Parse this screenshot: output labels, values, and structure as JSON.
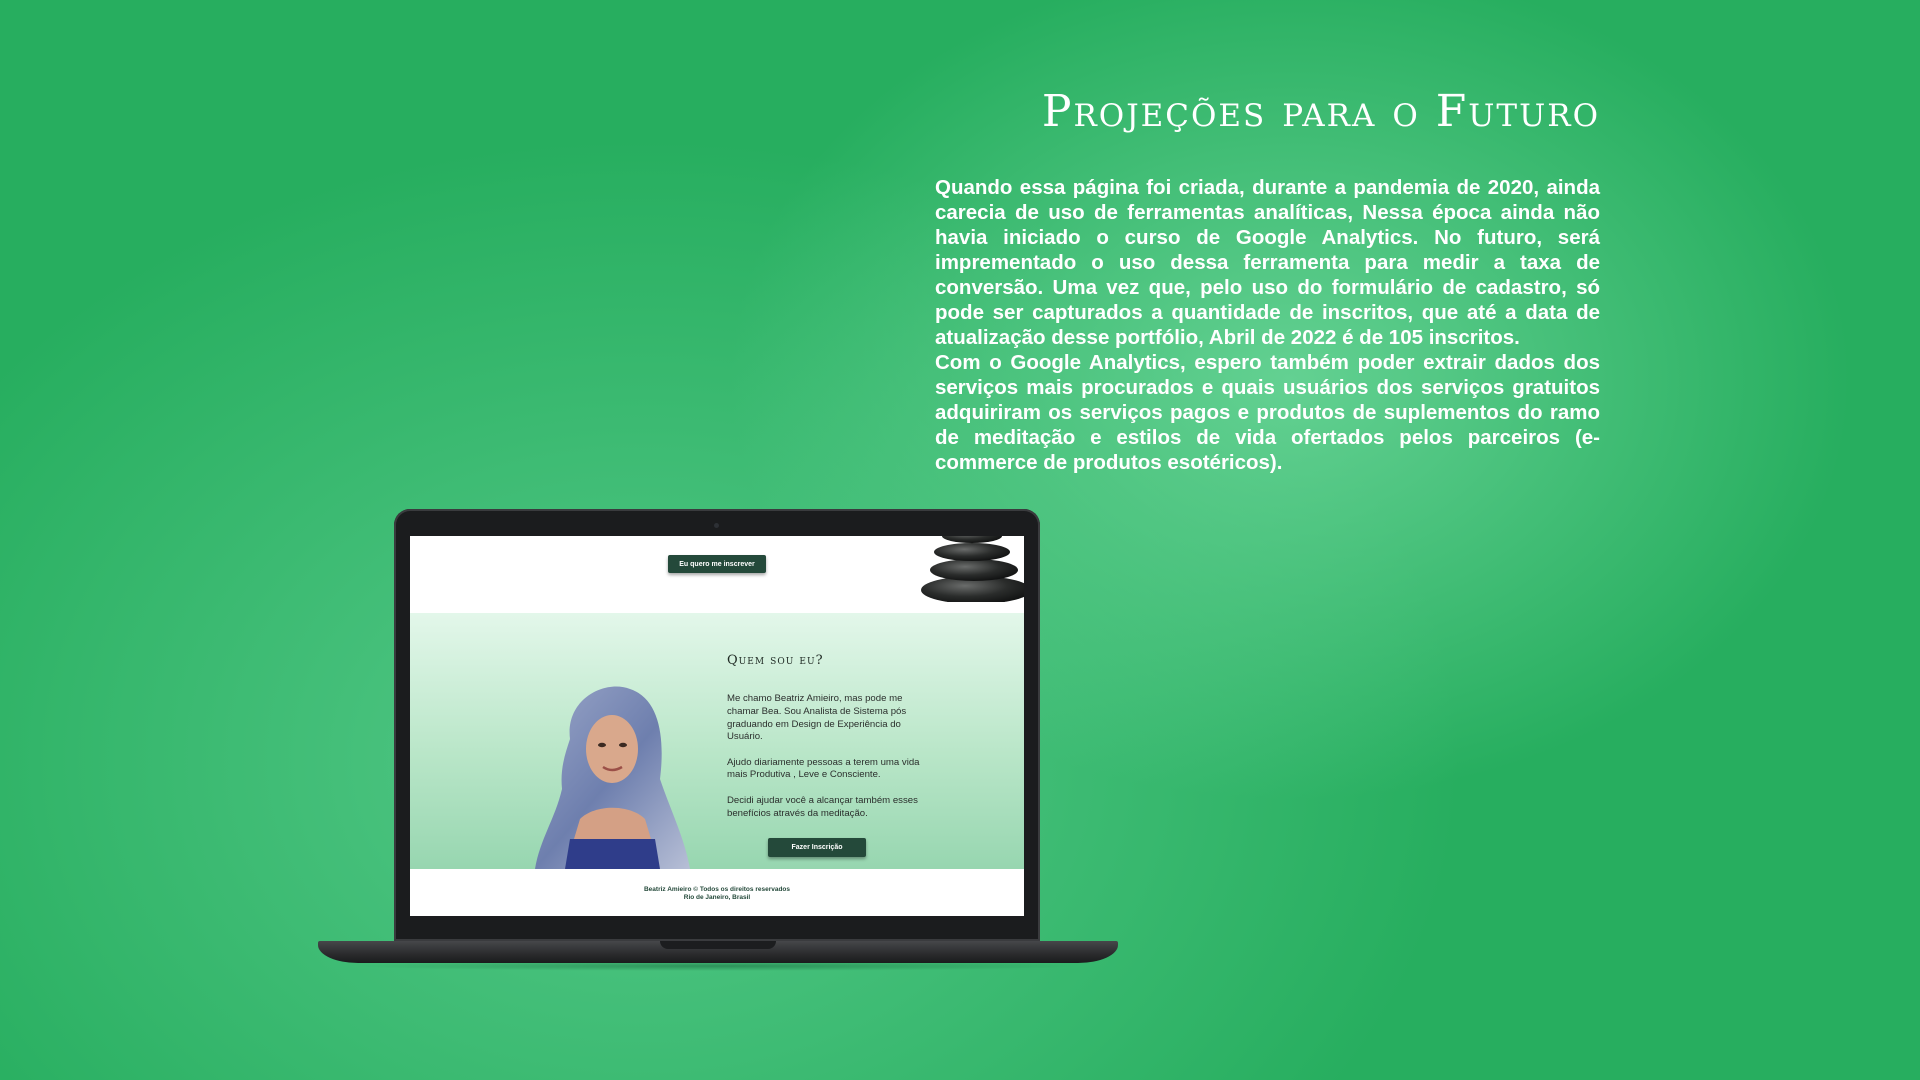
{
  "heading": "Projeções para o Futuro",
  "description": {
    "p1": "Quando essa página foi criada, durante a pandemia de 2020, ainda carecia de uso de ferramentas analíticas, Nessa época ainda não havia iniciado o curso de Google Analytics. No futuro, será imprementado o uso dessa ferramenta para medir a taxa de conversão. Uma vez que, pelo uso do formulário de cadastro, só pode ser capturados a quantidade de inscritos, que até a data de atualização desse portfólio, Abril de 2022 é de 105 inscritos.",
    "p2": "Com o Google Analytics, espero também poder extrair dados dos serviços mais procurados e quais usuários dos serviços gratuitos adquiriram os serviços pagos e produtos de suplementos do ramo de meditação e estilos de vida ofertados pelos parceiros (e-commerce de produtos esotéricos)."
  },
  "laptop_screen": {
    "top_button": "Eu quero me inscrever",
    "about": {
      "title": "Quem sou eu?",
      "paragraphs": [
        "Me chamo Beatriz Amieiro, mas pode me chamar Bea. Sou Analista de Sistema pós graduando em Design de Experiência do Usuário.",
        "Ajudo diariamente pessoas a terem uma vida mais Produtiva , Leve e Consciente.",
        "Decidi ajudar você a alcançar também esses benefícios através da meditação."
      ],
      "button": "Fazer Inscrição"
    },
    "footer": {
      "line1": "Beatriz Amieiro © Todos os direitos reservados",
      "line2": "Rio de Janeiro, Brasil"
    }
  },
  "colors": {
    "background": "#27ae5f",
    "button": "#24493a",
    "text": "#ffffff"
  }
}
